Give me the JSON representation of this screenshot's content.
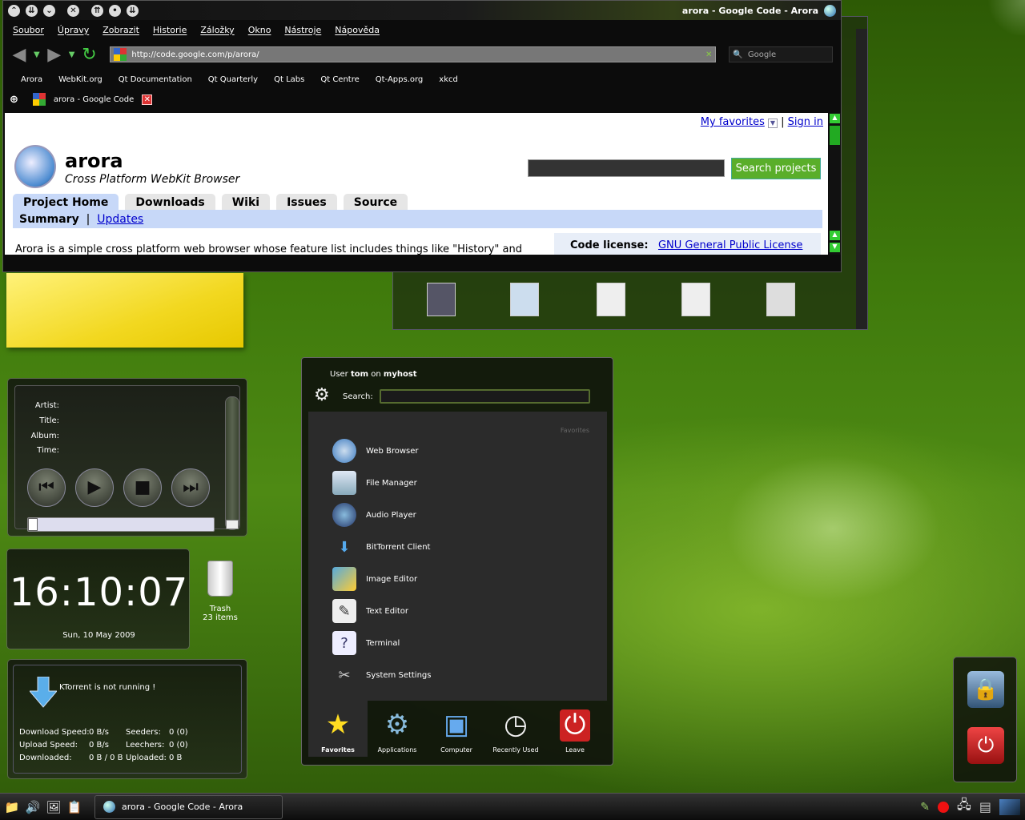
{
  "browser": {
    "window_title": "arora - Google Code - Arora",
    "menu": [
      "Soubor",
      "Úpravy",
      "Zobrazit",
      "Historie",
      "Záložky",
      "Okno",
      "Nástroje",
      "Nápověda"
    ],
    "url": "http://code.google.com/p/arora/",
    "search_placeholder": "Google",
    "bookmarks": [
      "Arora",
      "WebKit.org",
      "Qt Documentation",
      "Qt Quarterly",
      "Qt Labs",
      "Qt Centre",
      "Qt-Apps.org",
      "xkcd"
    ],
    "tab_title": "arora - Google Code"
  },
  "page": {
    "my_favorites": "My favorites",
    "separator": "|",
    "sign_in": "Sign in",
    "project_name": "arora",
    "project_subtitle": "Cross Platform WebKit Browser",
    "search_button": "Search projects",
    "tabs": [
      "Project Home",
      "Downloads",
      "Wiki",
      "Issues",
      "Source"
    ],
    "subnav_summary": "Summary",
    "subnav_updates": "Updates",
    "description": "Arora is a simple cross platform web browser whose feature list includes things like \"History\" and",
    "license_label": "Code license:",
    "license_link": "GNU General Public License"
  },
  "player": {
    "labels": [
      "Artist:",
      "Title:",
      "Album:",
      "Time:"
    ],
    "seek_position": 0,
    "volume_level": 0
  },
  "clock": {
    "time": "16:10:07",
    "date": "Sun, 10 May 2009"
  },
  "trash": {
    "label": "Trash",
    "count": "23 items"
  },
  "ktorrent": {
    "status": "KTorrent is not running !",
    "download_speed_label": "Download Speed:",
    "download_speed": "0 B/s",
    "upload_speed_label": "Upload Speed:",
    "upload_speed": "0 B/s",
    "downloaded_label": "Downloaded:",
    "downloaded": "0 B / 0 B",
    "seeders_label": "Seeders:",
    "seeders": "0 (0)",
    "leechers_label": "Leechers:",
    "leechers": "0 (0)",
    "uploaded_label": "Uploaded:",
    "uploaded": "0 B"
  },
  "kickoff": {
    "user_prefix": "User",
    "user": "tom",
    "host_prefix": "on",
    "host": "myhost",
    "search_label": "Search:",
    "section_label": "Favorites",
    "items": [
      "Web Browser",
      "File Manager",
      "Audio Player",
      "BitTorrent Client",
      "Image Editor",
      "Text Editor",
      "Terminal",
      "System Settings"
    ],
    "tabs": [
      "Favorites",
      "Applications",
      "Computer",
      "Recently Used",
      "Leave"
    ]
  },
  "taskbar": {
    "task_title": "arora - Google Code - Arora"
  },
  "colors": {
    "accent_green": "#5aae2a",
    "link_blue": "#0000cc",
    "tab_blue": "#c7d8f8"
  }
}
